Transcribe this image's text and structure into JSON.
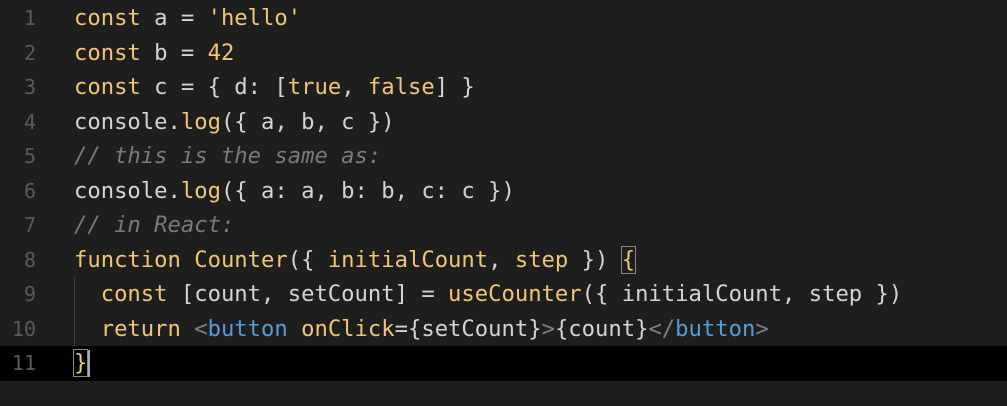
{
  "editor": {
    "colors": {
      "background": "#1e1e1e",
      "current_line": "#000000",
      "keyword": "#f0c674",
      "text": "#d4d4d4",
      "comment": "#7a7a7a",
      "tag": "#569cd6",
      "line_number": "#5a5a5a"
    },
    "current_line_number": 11,
    "lines": [
      {
        "number": "1",
        "tokens": [
          [
            "kw",
            "const"
          ],
          [
            "plain",
            " a = "
          ],
          [
            "str",
            "'hello'"
          ]
        ]
      },
      {
        "number": "2",
        "tokens": [
          [
            "kw",
            "const"
          ],
          [
            "plain",
            " b = "
          ],
          [
            "num",
            "42"
          ]
        ]
      },
      {
        "number": "3",
        "tokens": [
          [
            "kw",
            "const"
          ],
          [
            "plain",
            " c = { d: ["
          ],
          [
            "kw",
            "true"
          ],
          [
            "plain",
            ", "
          ],
          [
            "kw",
            "false"
          ],
          [
            "plain",
            "] }"
          ]
        ]
      },
      {
        "number": "4",
        "tokens": [
          [
            "plain",
            "console."
          ],
          [
            "fn",
            "log"
          ],
          [
            "plain",
            "({ a, b, c })"
          ]
        ]
      },
      {
        "number": "5",
        "tokens": [
          [
            "cm",
            "// this is the same as:"
          ]
        ]
      },
      {
        "number": "6",
        "tokens": [
          [
            "plain",
            "console."
          ],
          [
            "fn",
            "log"
          ],
          [
            "plain",
            "({ a: a, b: b, c: c })"
          ]
        ]
      },
      {
        "number": "7",
        "tokens": [
          [
            "cm",
            "// in React:"
          ]
        ]
      },
      {
        "number": "8",
        "tokens": [
          [
            "kw",
            "function"
          ],
          [
            "plain",
            " "
          ],
          [
            "fn",
            "Counter"
          ],
          [
            "plain",
            "({ "
          ],
          [
            "attr",
            "initialCount"
          ],
          [
            "plain",
            ", "
          ],
          [
            "attr",
            "step"
          ],
          [
            "plain",
            " }) "
          ],
          [
            "bracket-hl",
            "{"
          ]
        ]
      },
      {
        "number": "9",
        "tokens": [
          [
            "plain",
            "  "
          ],
          [
            "kw",
            "const"
          ],
          [
            "plain",
            " [count, setCount] = "
          ],
          [
            "fn",
            "useCounter"
          ],
          [
            "plain",
            "({ initialCount, step })"
          ]
        ]
      },
      {
        "number": "10",
        "tokens": [
          [
            "plain",
            "  "
          ],
          [
            "kw",
            "return"
          ],
          [
            "plain",
            " "
          ],
          [
            "tagpunct",
            "<"
          ],
          [
            "tag",
            "button"
          ],
          [
            "plain",
            " "
          ],
          [
            "attr",
            "onClick"
          ],
          [
            "plain",
            "={setCount}"
          ],
          [
            "tagpunct",
            ">"
          ],
          [
            "plain",
            "{count}"
          ],
          [
            "tagpunct",
            "</"
          ],
          [
            "tag",
            "button"
          ],
          [
            "tagpunct",
            ">"
          ]
        ]
      },
      {
        "number": "11",
        "tokens": [
          [
            "bracket-hl",
            "}"
          ]
        ]
      }
    ]
  }
}
